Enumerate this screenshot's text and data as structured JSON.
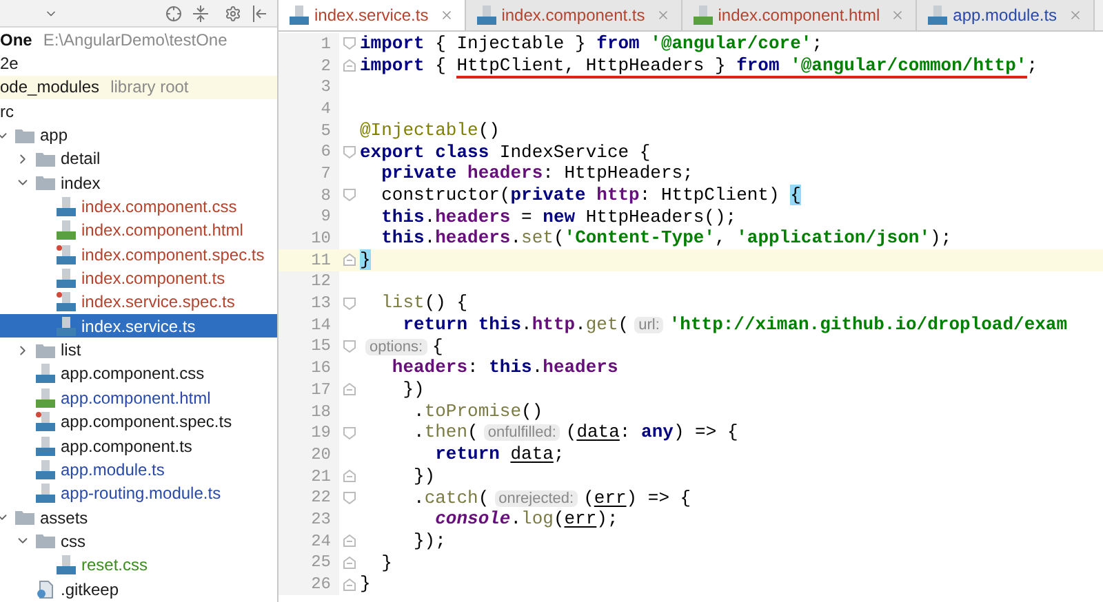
{
  "project_tree": {
    "items": [
      {
        "label": "One",
        "note": "E:\\AngularDemo\\testOne",
        "kind": "project",
        "color": "#111111",
        "selected": false,
        "children": [
          {
            "label": "2e",
            "kind": "folder",
            "color": "#1a1a1a",
            "selected": false
          },
          {
            "label": "ode_modules",
            "note": "library root",
            "kind": "library",
            "color": "#1a1a1a",
            "selected": false
          },
          {
            "label": "rc",
            "kind": "folder",
            "color": "#1a1a1a",
            "selected": false,
            "children": [
              {
                "label": "app",
                "kind": "folder",
                "color": "#1a1a1a",
                "expanded": true,
                "selected": false,
                "children": [
                  {
                    "label": "detail",
                    "kind": "folder",
                    "color": "#1a1a1a",
                    "expanded": false,
                    "selected": false
                  },
                  {
                    "label": "index",
                    "kind": "folder",
                    "color": "#1a1a1a",
                    "expanded": true,
                    "selected": false,
                    "children": [
                      {
                        "label": "index.component.css",
                        "kind": "css",
                        "color": "#b5432e",
                        "selected": false
                      },
                      {
                        "label": "index.component.html",
                        "kind": "html",
                        "color": "#b5432e",
                        "selected": false
                      },
                      {
                        "label": "index.component.spec.ts",
                        "kind": "spec",
                        "color": "#b5432e",
                        "selected": false
                      },
                      {
                        "label": "index.component.ts",
                        "kind": "ts",
                        "color": "#b5432e",
                        "selected": false
                      },
                      {
                        "label": "index.service.spec.ts",
                        "kind": "spec",
                        "color": "#b5432e",
                        "selected": false
                      },
                      {
                        "label": "index.service.ts",
                        "kind": "ts",
                        "selected": true
                      }
                    ]
                  },
                  {
                    "label": "list",
                    "kind": "folder",
                    "color": "#1a1a1a",
                    "expanded": false,
                    "selected": false
                  },
                  {
                    "label": "app.component.css",
                    "kind": "css",
                    "color": "#1a1a1a",
                    "selected": false
                  },
                  {
                    "label": "app.component.html",
                    "kind": "html",
                    "color": "#2849a8",
                    "selected": false
                  },
                  {
                    "label": "app.component.spec.ts",
                    "kind": "spec",
                    "color": "#1a1a1a",
                    "selected": false
                  },
                  {
                    "label": "app.component.ts",
                    "kind": "ts",
                    "color": "#1a1a1a",
                    "selected": false
                  },
                  {
                    "label": "app.module.ts",
                    "kind": "ts",
                    "color": "#2849a8",
                    "selected": false
                  },
                  {
                    "label": "app-routing.module.ts",
                    "kind": "ts",
                    "color": "#2849a8",
                    "selected": false
                  }
                ]
              },
              {
                "label": "assets",
                "kind": "folder",
                "color": "#1a1a1a",
                "expanded": true,
                "selected": false,
                "children": [
                  {
                    "label": "css",
                    "kind": "folder",
                    "color": "#1a1a1a",
                    "expanded": true,
                    "selected": false,
                    "children": [
                      {
                        "label": "reset.css",
                        "kind": "css",
                        "color": "#3d8c1f",
                        "selected": false
                      }
                    ]
                  },
                  {
                    "label": ".gitkeep",
                    "kind": "file",
                    "color": "#1a1a1a",
                    "selected": false
                  }
                ]
              }
            ]
          }
        ]
      }
    ]
  },
  "editor_tabs": [
    {
      "label": "index.service.ts",
      "kind": "ts",
      "color": "#b5432e",
      "selected": true
    },
    {
      "label": "index.component.ts",
      "kind": "ts",
      "color": "#b5432e",
      "selected": false
    },
    {
      "label": "index.component.html",
      "kind": "html",
      "color": "#b5432e",
      "selected": false
    },
    {
      "label": "app.module.ts",
      "kind": "ts",
      "color": "#2849a8",
      "selected": false
    }
  ],
  "code_lines": [
    {
      "number": "1",
      "current": false,
      "fold_start": true,
      "fold_end": false,
      "tokens": [
        {
          "kind": "kw",
          "text": "import"
        },
        {
          "kind": "plain",
          "text": " { Injectable } "
        },
        {
          "kind": "kw",
          "text": "from "
        },
        {
          "kind": "str",
          "text": "'@angular/core'"
        },
        {
          "kind": "plain",
          "text": ";"
        }
      ]
    },
    {
      "number": "2",
      "current": false,
      "fold_start": false,
      "fold_end": true,
      "tokens": [
        {
          "kind": "kw",
          "text": "import"
        },
        {
          "kind": "plain",
          "text": " { "
        },
        {
          "kind": "underlined",
          "tokens": [
            {
              "kind": "plain",
              "text": "HttpClient, HttpHeaders } "
            },
            {
              "kind": "kw",
              "text": "from "
            },
            {
              "kind": "str",
              "text": "'@angular/common/http'"
            }
          ]
        },
        {
          "kind": "plain",
          "text": ";"
        }
      ]
    },
    {
      "number": "3",
      "current": false,
      "fold_start": false,
      "fold_end": false
    },
    {
      "number": "4",
      "current": false,
      "fold_start": false,
      "fold_end": false
    },
    {
      "number": "5",
      "current": false,
      "fold_start": false,
      "fold_end": false,
      "tokens": [
        {
          "kind": "deco",
          "text": "@Injectable"
        },
        {
          "kind": "plain",
          "text": "()"
        }
      ]
    },
    {
      "number": "6",
      "current": false,
      "fold_start": true,
      "fold_end": false,
      "tokens": [
        {
          "kind": "kw",
          "text": "export class"
        },
        {
          "kind": "plain",
          "text": " IndexService {"
        }
      ]
    },
    {
      "number": "7",
      "current": false,
      "fold_start": false,
      "fold_end": false,
      "tokens": [
        {
          "kind": "kw",
          "text": "  private "
        },
        {
          "kind": "field",
          "text": "headers"
        },
        {
          "kind": "plain",
          "text": ": HttpHeaders;"
        }
      ]
    },
    {
      "number": "8",
      "current": false,
      "fold_start": true,
      "fold_end": false,
      "tokens": [
        {
          "kind": "plain",
          "text": "  constructor("
        },
        {
          "kind": "kw",
          "text": "private "
        },
        {
          "kind": "field",
          "text": "http"
        },
        {
          "kind": "plain",
          "text": ": HttpClient) "
        },
        {
          "kind": "brace",
          "text": "{"
        }
      ]
    },
    {
      "number": "9",
      "current": false,
      "fold_start": false,
      "fold_end": false,
      "tokens": [
        {
          "kind": "kw",
          "text": "  this"
        },
        {
          "kind": "plain",
          "text": "."
        },
        {
          "kind": "field",
          "text": "headers"
        },
        {
          "kind": "plain",
          "text": " = "
        },
        {
          "kind": "kw",
          "text": "new"
        },
        {
          "kind": "plain",
          "text": " HttpHeaders();"
        }
      ]
    },
    {
      "number": "10",
      "current": false,
      "fold_start": false,
      "fold_end": false,
      "tokens": [
        {
          "kind": "kw",
          "text": "  this"
        },
        {
          "kind": "plain",
          "text": "."
        },
        {
          "kind": "field",
          "text": "headers"
        },
        {
          "kind": "plain",
          "text": "."
        },
        {
          "kind": "method",
          "text": "set"
        },
        {
          "kind": "plain",
          "text": "("
        },
        {
          "kind": "str",
          "text": "'Content-Type'"
        },
        {
          "kind": "plain",
          "text": ", "
        },
        {
          "kind": "str",
          "text": "'application/json'"
        },
        {
          "kind": "plain",
          "text": ");"
        }
      ]
    },
    {
      "number": "11",
      "current": true,
      "fold_start": false,
      "fold_end": true,
      "tokens": [
        {
          "kind": "brace",
          "text": "}"
        }
      ]
    },
    {
      "number": "12",
      "current": false,
      "fold_start": false,
      "fold_end": false
    },
    {
      "number": "13",
      "current": false,
      "fold_start": true,
      "fold_end": false,
      "tokens": [
        {
          "kind": "method",
          "text": "  list"
        },
        {
          "kind": "plain",
          "text": "() {"
        }
      ]
    },
    {
      "number": "14",
      "current": false,
      "fold_start": false,
      "fold_end": false,
      "tokens": [
        {
          "kind": "kw",
          "text": "    return this"
        },
        {
          "kind": "plain",
          "text": "."
        },
        {
          "kind": "field",
          "text": "http"
        },
        {
          "kind": "plain",
          "text": "."
        },
        {
          "kind": "method",
          "text": "get"
        },
        {
          "kind": "plain",
          "text": "("
        },
        {
          "kind": "hint",
          "text": "url:"
        },
        {
          "kind": "str",
          "text": "'http://ximan.github.io/dropload/exam"
        }
      ]
    },
    {
      "number": "15",
      "current": false,
      "fold_start": true,
      "fold_end": false,
      "tokens": [
        {
          "kind": "hint",
          "text": "options:"
        },
        {
          "kind": "plain",
          "text": "{"
        }
      ]
    },
    {
      "number": "16",
      "current": false,
      "fold_start": false,
      "fold_end": false,
      "tokens": [
        {
          "kind": "field",
          "text": "   headers"
        },
        {
          "kind": "plain",
          "text": ": "
        },
        {
          "kind": "kw",
          "text": "this"
        },
        {
          "kind": "plain",
          "text": "."
        },
        {
          "kind": "field",
          "text": "headers"
        }
      ]
    },
    {
      "number": "17",
      "current": false,
      "fold_start": false,
      "fold_end": true,
      "tokens": [
        {
          "kind": "plain",
          "text": "    })"
        }
      ]
    },
    {
      "number": "18",
      "current": false,
      "fold_start": false,
      "fold_end": false,
      "tokens": [
        {
          "kind": "plain",
          "text": "     ."
        },
        {
          "kind": "method",
          "text": "toPromise"
        },
        {
          "kind": "plain",
          "text": "()"
        }
      ]
    },
    {
      "number": "19",
      "current": false,
      "fold_start": true,
      "fold_end": false,
      "tokens": [
        {
          "kind": "plain",
          "text": "     ."
        },
        {
          "kind": "method",
          "text": "then"
        },
        {
          "kind": "plain",
          "text": "("
        },
        {
          "kind": "hint",
          "text": "onfulfilled:"
        },
        {
          "kind": "plain",
          "text": "("
        },
        {
          "kind": "param",
          "text": "data"
        },
        {
          "kind": "plain",
          "text": ": "
        },
        {
          "kind": "kw",
          "text": "any"
        },
        {
          "kind": "plain",
          "text": ") => {"
        }
      ]
    },
    {
      "number": "20",
      "current": false,
      "fold_start": false,
      "fold_end": false,
      "tokens": [
        {
          "kind": "kw",
          "text": "       return "
        },
        {
          "kind": "param",
          "text": "data"
        },
        {
          "kind": "plain",
          "text": ";"
        }
      ]
    },
    {
      "number": "21",
      "current": false,
      "fold_start": false,
      "fold_end": true,
      "tokens": [
        {
          "kind": "plain",
          "text": "     })"
        }
      ]
    },
    {
      "number": "22",
      "current": false,
      "fold_start": true,
      "fold_end": false,
      "tokens": [
        {
          "kind": "plain",
          "text": "     ."
        },
        {
          "kind": "method",
          "text": "catch"
        },
        {
          "kind": "plain",
          "text": "("
        },
        {
          "kind": "hint",
          "text": "onrejected:"
        },
        {
          "kind": "plain",
          "text": "("
        },
        {
          "kind": "param",
          "text": "err"
        },
        {
          "kind": "plain",
          "text": ") => {"
        }
      ]
    },
    {
      "number": "23",
      "current": false,
      "fold_start": false,
      "fold_end": false,
      "tokens": [
        {
          "kind": "italic",
          "text": "       console"
        },
        {
          "kind": "plain",
          "text": "."
        },
        {
          "kind": "method",
          "text": "log"
        },
        {
          "kind": "plain",
          "text": "("
        },
        {
          "kind": "param",
          "text": "err"
        },
        {
          "kind": "plain",
          "text": ");"
        }
      ]
    },
    {
      "number": "24",
      "current": false,
      "fold_start": false,
      "fold_end": true,
      "tokens": [
        {
          "kind": "plain",
          "text": "     });"
        }
      ]
    },
    {
      "number": "25",
      "current": false,
      "fold_start": false,
      "fold_end": true,
      "tokens": [
        {
          "kind": "plain",
          "text": "  }"
        }
      ]
    },
    {
      "number": "26",
      "current": false,
      "fold_start": false,
      "fold_end": true,
      "tokens": [
        {
          "kind": "plain",
          "text": "}"
        }
      ]
    }
  ]
}
